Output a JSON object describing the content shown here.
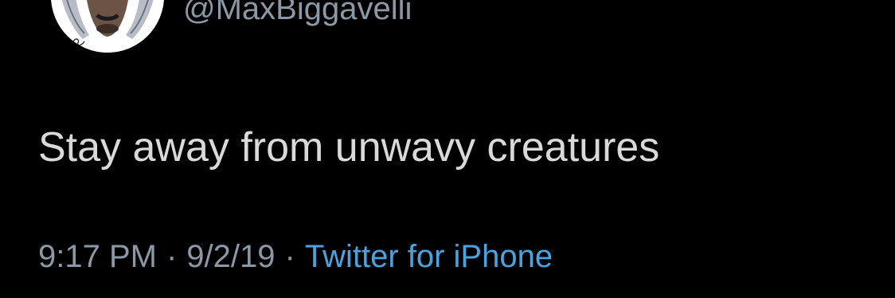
{
  "tweet": {
    "handle": "@MaxBiggavelli",
    "text": "Stay away from unwavy creatures",
    "time": "9:17 PM",
    "separator": "·",
    "date": "9/2/19",
    "source": "Twitter for iPhone"
  },
  "colors": {
    "background": "#000000",
    "text": "#d9d9d9",
    "secondary": "#8b98a5",
    "link": "#4aa3df"
  },
  "icons": {
    "avatar": "illustrated-portrait-avatar"
  }
}
